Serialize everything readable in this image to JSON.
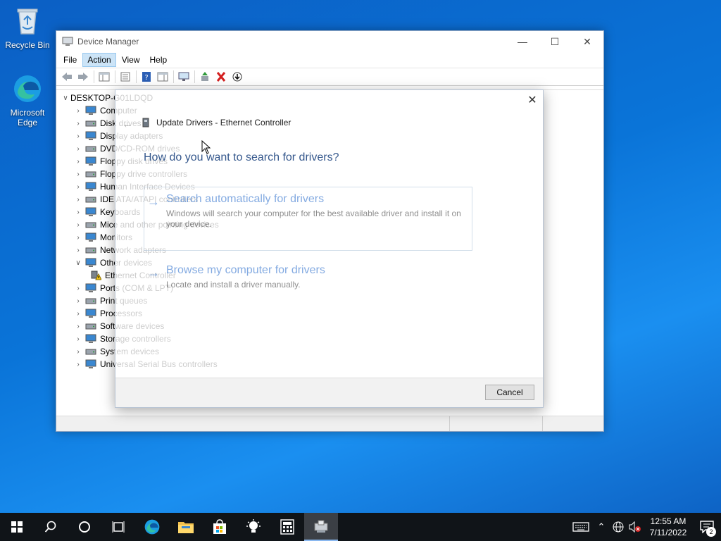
{
  "desktop": {
    "icons": [
      {
        "label": "Recycle Bin"
      },
      {
        "label": "Microsoft Edge"
      }
    ]
  },
  "device_manager": {
    "title": "Device Manager",
    "menu": [
      "File",
      "Action",
      "View",
      "Help"
    ],
    "active_menu": "Action",
    "tree": {
      "root": "DESKTOP-G01LDQD",
      "items": [
        {
          "label": "Computer",
          "expanded": false
        },
        {
          "label": "Disk drives",
          "expanded": false
        },
        {
          "label": "Display adapters",
          "expanded": false
        },
        {
          "label": "DVD/CD-ROM drives",
          "expanded": false
        },
        {
          "label": "Floppy disk drives",
          "expanded": false
        },
        {
          "label": "Floppy drive controllers",
          "expanded": false
        },
        {
          "label": "Human Interface Devices",
          "expanded": false
        },
        {
          "label": "IDE ATA/ATAPI controllers",
          "expanded": false
        },
        {
          "label": "Keyboards",
          "expanded": false
        },
        {
          "label": "Mice and other pointing devices",
          "expanded": false
        },
        {
          "label": "Monitors",
          "expanded": false
        },
        {
          "label": "Network adapters",
          "expanded": false
        },
        {
          "label": "Other devices",
          "expanded": true
        },
        {
          "label": "Ethernet Controller",
          "child": true
        },
        {
          "label": "Ports (COM & LPT)",
          "expanded": false
        },
        {
          "label": "Print queues",
          "expanded": false
        },
        {
          "label": "Processors",
          "expanded": false
        },
        {
          "label": "Software devices",
          "expanded": false
        },
        {
          "label": "Storage controllers",
          "expanded": false
        },
        {
          "label": "System devices",
          "expanded": false
        },
        {
          "label": "Universal Serial Bus controllers",
          "expanded": false
        }
      ]
    }
  },
  "update_dialog": {
    "header": "Update Drivers - Ethernet Controller",
    "question": "How do you want to search for drivers?",
    "option_auto": {
      "title": "Search automatically for drivers",
      "description": "Windows will search your computer for the best available driver and install it on your device."
    },
    "option_browse": {
      "title": "Browse my computer for drivers",
      "description": "Locate and install a driver manually."
    },
    "cancel_label": "Cancel"
  },
  "taskbar": {
    "time": "12:55 AM",
    "date": "7/11/2022",
    "notification_count": "2"
  },
  "colors": {
    "accent": "#0078d7",
    "taskbar": "#101418",
    "link_blue": "#1e64c8"
  }
}
